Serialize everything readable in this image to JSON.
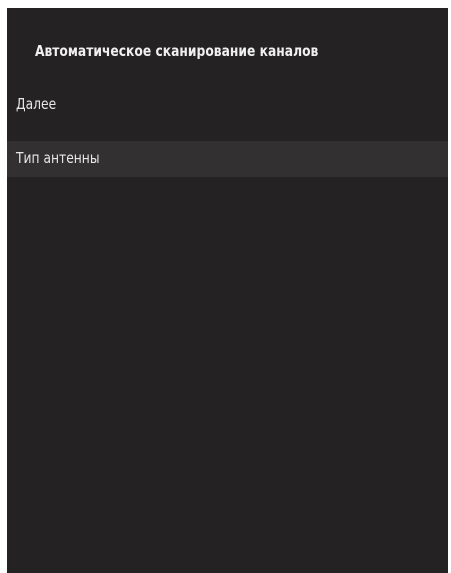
{
  "screen": {
    "title": "Автоматическое сканирование каналов",
    "menu": [
      {
        "label": "Далее",
        "selected": false
      },
      {
        "label": "Тип антенны",
        "selected": true
      }
    ]
  },
  "colors": {
    "panel_background": "#252223",
    "selected_row": "#323031",
    "text": "#e8e8e8"
  }
}
